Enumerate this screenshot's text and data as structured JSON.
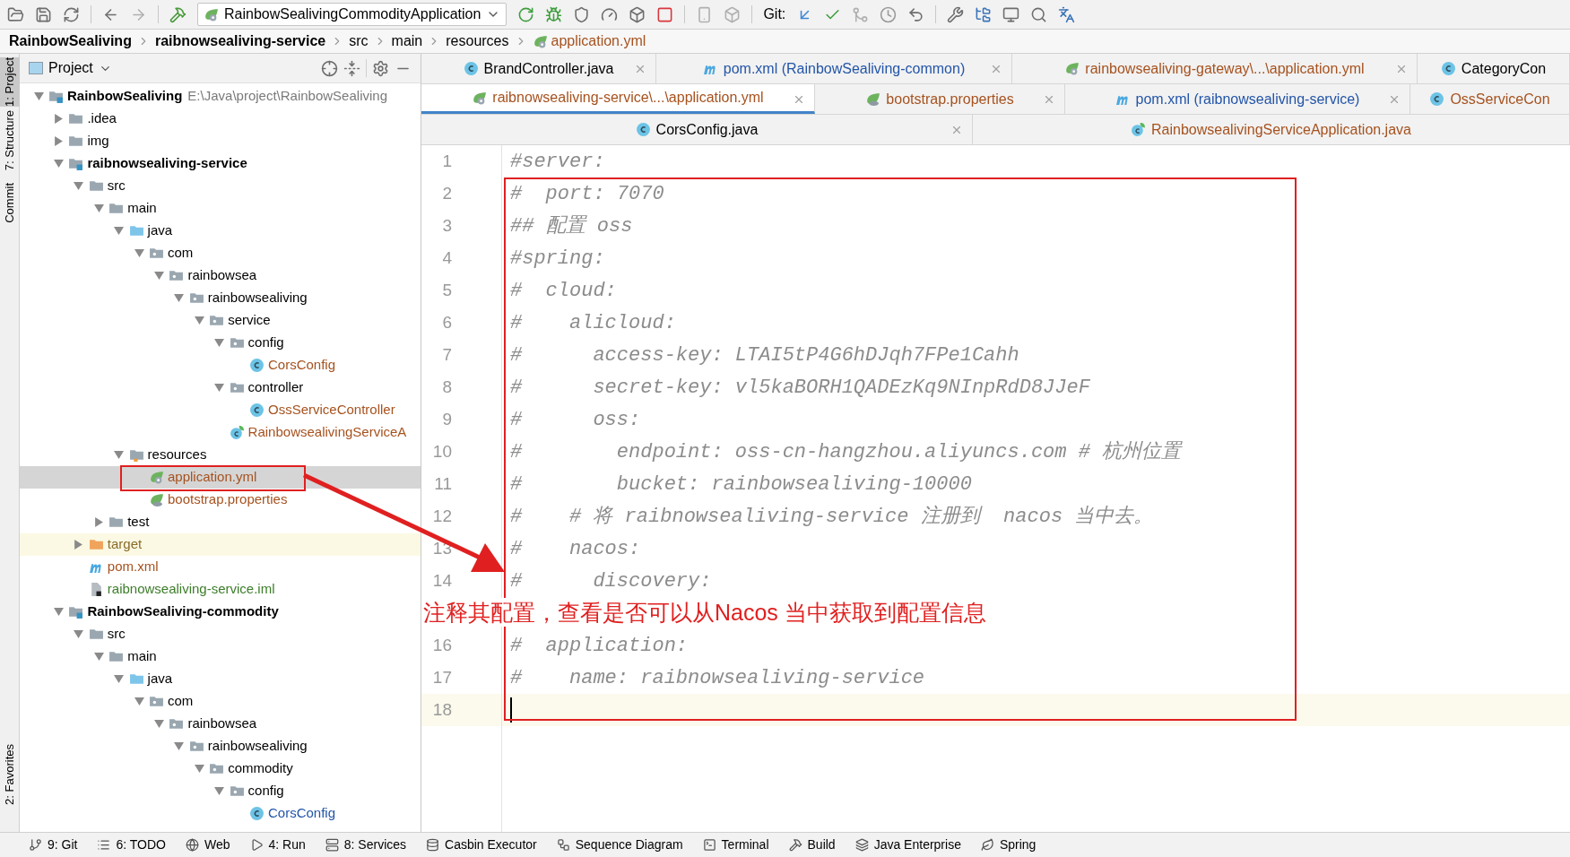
{
  "toolbar": {
    "run_config": "RainbowSealivingCommodityApplication",
    "git_label": "Git:"
  },
  "breadcrumbs": [
    {
      "label": "RainbowSealiving",
      "kind": "module",
      "color": "#000000"
    },
    {
      "label": "raibnowsealiving-service",
      "kind": "module",
      "color": "#000000"
    },
    {
      "label": "src",
      "kind": "folder",
      "color": "#000000"
    },
    {
      "label": "main",
      "kind": "folder",
      "color": "#000000"
    },
    {
      "label": "resources",
      "kind": "folder",
      "color": "#000000"
    },
    {
      "label": "application.yml",
      "kind": "yml",
      "color": "#a6521f"
    }
  ],
  "tool_stripe": [
    {
      "label": "1: Project",
      "selected": true
    },
    {
      "label": "7: Structure",
      "selected": false
    },
    {
      "label": "Commit",
      "selected": false
    },
    {
      "label": "2: Favorites",
      "selected": false
    }
  ],
  "project_panel": {
    "title": "Project",
    "tree": [
      {
        "label": "RainbowSealiving",
        "kind": "module",
        "color": "#000000",
        "selected": false,
        "expanded": true,
        "hint": "E:\\Java\\project\\RainbowSealiving",
        "children": [
          {
            "label": ".idea",
            "kind": "folder",
            "color": "#000000",
            "selected": false,
            "expanded": false
          },
          {
            "label": "img",
            "kind": "folder",
            "color": "#000000",
            "selected": false,
            "expanded": false
          },
          {
            "label": "raibnowsealiving-service",
            "kind": "module",
            "color": "#000000",
            "selected": false,
            "expanded": true,
            "children": [
              {
                "label": "src",
                "kind": "folder",
                "color": "#000000",
                "selected": false,
                "expanded": true,
                "children": [
                  {
                    "label": "main",
                    "kind": "folder",
                    "color": "#000000",
                    "selected": false,
                    "expanded": true,
                    "children": [
                      {
                        "label": "java",
                        "kind": "source",
                        "color": "#000000",
                        "selected": false,
                        "expanded": true,
                        "children": [
                          {
                            "label": "com",
                            "kind": "package",
                            "color": "#000000",
                            "selected": false,
                            "expanded": true,
                            "children": [
                              {
                                "label": "rainbowsea",
                                "kind": "package",
                                "color": "#000000",
                                "selected": false,
                                "expanded": true,
                                "children": [
                                  {
                                    "label": "rainbowsealiving",
                                    "kind": "package",
                                    "color": "#000000",
                                    "selected": false,
                                    "expanded": true,
                                    "children": [
                                      {
                                        "label": "service",
                                        "kind": "package",
                                        "color": "#000000",
                                        "selected": false,
                                        "expanded": true,
                                        "children": [
                                          {
                                            "label": "config",
                                            "kind": "package",
                                            "color": "#000000",
                                            "selected": false,
                                            "expanded": true,
                                            "children": [
                                              {
                                                "label": "CorsConfig",
                                                "kind": "class",
                                                "color": "#a6521f",
                                                "selected": false
                                              }
                                            ]
                                          },
                                          {
                                            "label": "controller",
                                            "kind": "package",
                                            "color": "#000000",
                                            "selected": false,
                                            "expanded": true,
                                            "children": [
                                              {
                                                "label": "OssServiceController",
                                                "kind": "class",
                                                "color": "#a6521f",
                                                "selected": false
                                              }
                                            ]
                                          },
                                          {
                                            "label": "RainbowsealivingServiceA",
                                            "kind": "spring-class",
                                            "color": "#a6521f",
                                            "selected": false
                                          }
                                        ]
                                      }
                                    ]
                                  }
                                ]
                              }
                            ]
                          }
                        ]
                      },
                      {
                        "label": "resources",
                        "kind": "resources",
                        "color": "#000000",
                        "selected": false,
                        "expanded": true,
                        "children": [
                          {
                            "label": "application.yml",
                            "kind": "yml",
                            "color": "#a6521f",
                            "selected": true
                          },
                          {
                            "label": "bootstrap.properties",
                            "kind": "properties",
                            "color": "#a6521f",
                            "selected": false
                          }
                        ]
                      }
                    ]
                  },
                  {
                    "label": "test",
                    "kind": "folder",
                    "color": "#000000",
                    "selected": false,
                    "expanded": false
                  }
                ]
              },
              {
                "label": "target",
                "kind": "excluded",
                "color": "#8a6a2a",
                "selected": false,
                "expanded": false
              },
              {
                "label": "pom.xml",
                "kind": "maven",
                "color": "#a6521f",
                "selected": false
              },
              {
                "label": "raibnowsealiving-service.iml",
                "kind": "iml",
                "color": "#3d7d2a",
                "selected": false
              }
            ]
          },
          {
            "label": "RainbowSealiving-commodity",
            "kind": "module",
            "color": "#000000",
            "selected": false,
            "expanded": true,
            "children": [
              {
                "label": "src",
                "kind": "folder",
                "color": "#000000",
                "selected": false,
                "expanded": true,
                "children": [
                  {
                    "label": "main",
                    "kind": "folder",
                    "color": "#000000",
                    "selected": false,
                    "expanded": true,
                    "children": [
                      {
                        "label": "java",
                        "kind": "source",
                        "color": "#000000",
                        "selected": false,
                        "expanded": true,
                        "children": [
                          {
                            "label": "com",
                            "kind": "package",
                            "color": "#000000",
                            "selected": false,
                            "expanded": true,
                            "children": [
                              {
                                "label": "rainbowsea",
                                "kind": "package",
                                "color": "#000000",
                                "selected": false,
                                "expanded": true,
                                "children": [
                                  {
                                    "label": "rainbowsealiving",
                                    "kind": "package",
                                    "color": "#000000",
                                    "selected": false,
                                    "expanded": true,
                                    "children": [
                                      {
                                        "label": "commodity",
                                        "kind": "package",
                                        "color": "#000000",
                                        "selected": false,
                                        "expanded": true,
                                        "children": [
                                          {
                                            "label": "config",
                                            "kind": "package",
                                            "color": "#000000",
                                            "selected": false,
                                            "expanded": true,
                                            "children": [
                                              {
                                                "label": "CorsConfig",
                                                "kind": "class",
                                                "color": "#2355a8",
                                                "selected": false
                                              }
                                            ]
                                          }
                                        ]
                                      }
                                    ]
                                  }
                                ]
                              }
                            ]
                          }
                        ]
                      }
                    ]
                  }
                ]
              }
            ]
          }
        ]
      }
    ]
  },
  "editor_tabs": {
    "rows": [
      {
        "tabs": [
          {
            "label": "BrandController.java",
            "kind": "class",
            "color": "#000000",
            "selected": false,
            "closable": true
          },
          {
            "label": "pom.xml (RainbowSealiving-common)",
            "kind": "maven",
            "color": "#2355a8",
            "selected": false,
            "closable": true
          },
          {
            "label": "rainbowsealiving-gateway\\...\\application.yml",
            "kind": "yml",
            "color": "#a6521f",
            "selected": false,
            "closable": true
          },
          {
            "label": "CategoryCon",
            "kind": "class",
            "color": "#000000",
            "selected": false,
            "closable": false
          }
        ]
      },
      {
        "tabs": [
          {
            "label": "raibnowsealiving-service\\...\\application.yml",
            "kind": "yml",
            "color": "#a6521f",
            "selected": true,
            "closable": true
          },
          {
            "label": "bootstrap.properties",
            "kind": "properties",
            "color": "#a6521f",
            "selected": false,
            "closable": true
          },
          {
            "label": "pom.xml (raibnowsealiving-service)",
            "kind": "maven",
            "color": "#2355a8",
            "selected": false,
            "closable": true
          },
          {
            "label": "OssServiceCon",
            "kind": "class",
            "color": "#a6521f",
            "selected": false,
            "closable": false
          }
        ]
      },
      {
        "tabs": [
          {
            "label": "CorsConfig.java",
            "kind": "class",
            "color": "#000000",
            "selected": false,
            "closable": true
          },
          {
            "label": "RainbowsealivingServiceApplication.java",
            "kind": "spring-class",
            "color": "#a6521f",
            "selected": false,
            "closable": false
          }
        ]
      }
    ]
  },
  "editor": {
    "lines": [
      {
        "kind": "code",
        "number": "1",
        "text": "#server:",
        "current": false
      },
      {
        "kind": "code",
        "number": "2",
        "text": "#  port: 7070",
        "current": false
      },
      {
        "kind": "code",
        "number": "3",
        "text": "## 配置 oss",
        "current": false
      },
      {
        "kind": "code",
        "number": "4",
        "text": "#spring:",
        "current": false
      },
      {
        "kind": "code",
        "number": "5",
        "text": "#  cloud:",
        "current": false
      },
      {
        "kind": "code",
        "number": "6",
        "text": "#    alicloud:",
        "current": false
      },
      {
        "kind": "code",
        "number": "7",
        "text": "#      access-key: LTAI5tP4G6hDJqh7FPe1Cahh",
        "current": false
      },
      {
        "kind": "code",
        "number": "8",
        "text": "#      secret-key: vl5kaBORH1QADEzKq9NInpRdD8JJeF",
        "current": false
      },
      {
        "kind": "code",
        "number": "9",
        "text": "#      oss:",
        "current": false
      },
      {
        "kind": "code",
        "number": "10",
        "text": "#        endpoint: oss-cn-hangzhou.aliyuncs.com # 杭州位置",
        "current": false
      },
      {
        "kind": "code",
        "number": "11",
        "text": "#        bucket: rainbowsealiving-10000",
        "current": false
      },
      {
        "kind": "code",
        "number": "12",
        "text": "#    # 将 raibnowsealiving-service 注册到  nacos 当中去。",
        "current": false
      },
      {
        "kind": "code",
        "number": "13",
        "text": "#    nacos:",
        "current": false
      },
      {
        "kind": "code",
        "number": "14",
        "text": "#      discovery:",
        "current": false
      },
      {
        "kind": "annotation",
        "text": "注释其配置，查看是否可以从Nacos 当中获取到配置信息"
      },
      {
        "kind": "code",
        "number": "16",
        "text": "#  application:",
        "current": false
      },
      {
        "kind": "code",
        "number": "17",
        "text": "#    name: raibnowsealiving-service",
        "current": false
      },
      {
        "kind": "code",
        "number": "18",
        "current": true
      }
    ]
  },
  "status_bar": [
    {
      "label": "9: Git",
      "kind": "git"
    },
    {
      "label": "6: TODO",
      "kind": "todo"
    },
    {
      "label": "Web",
      "kind": "web"
    },
    {
      "label": "4: Run",
      "kind": "run"
    },
    {
      "label": "8: Services",
      "kind": "services"
    },
    {
      "label": "Casbin Executor",
      "kind": "casbin"
    },
    {
      "label": "Sequence Diagram",
      "kind": "sequence"
    },
    {
      "label": "Terminal",
      "kind": "terminal"
    },
    {
      "label": "Build",
      "kind": "build"
    },
    {
      "label": "Java Enterprise",
      "kind": "enterprise"
    },
    {
      "label": "Spring",
      "kind": "spring"
    }
  ]
}
